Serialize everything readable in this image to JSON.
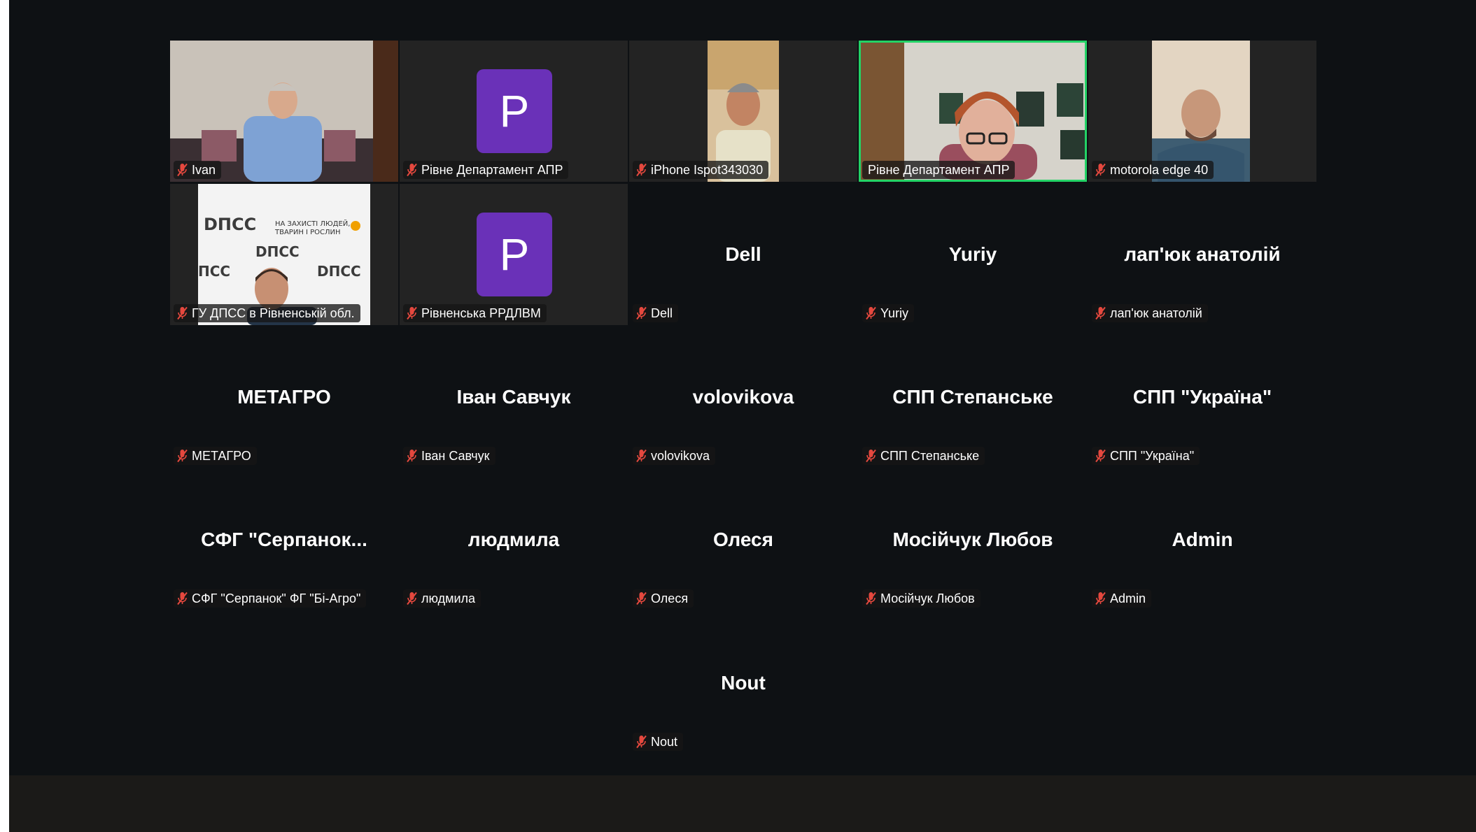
{
  "theme": {
    "background": "#0e1114",
    "tile_background": "#232323",
    "active_speaker_border": "#23d366",
    "avatar_color": "#6a31b8",
    "mute_icon_color": "#e5483e"
  },
  "participants": [
    {
      "label": "Ivan",
      "type": "video",
      "muted": true,
      "icon": "person-video"
    },
    {
      "label": "Рівне Департамент АПР",
      "type": "avatar",
      "avatar_letter": "P",
      "muted": true
    },
    {
      "label": "iPhone Ispot343030",
      "type": "video",
      "muted": true,
      "icon": "person-video"
    },
    {
      "label": "Рівне Департамент АПР",
      "type": "video",
      "active_speaker": true,
      "muted": false,
      "icon": "person-video"
    },
    {
      "label": "motorola edge 40",
      "type": "video",
      "muted": true,
      "icon": "person-video"
    },
    {
      "label": "ГУ ДПСС в Рівненській обл.",
      "type": "video",
      "muted": true,
      "icon": "person-video",
      "backdrop_text": [
        "ДПСС",
        "НА ЗАХИСТІ ЛЮДЕЙ,",
        "ТВАРИН І РОСЛИН"
      ]
    },
    {
      "label": "Рівненська РРДЛВМ",
      "type": "avatar",
      "avatar_letter": "P",
      "muted": true
    },
    {
      "label": "Dell",
      "type": "name",
      "display_name": "Dell",
      "muted": true
    },
    {
      "label": "Yuriy",
      "type": "name",
      "display_name": "Yuriy",
      "muted": true
    },
    {
      "label": "лап'юк анатолій",
      "type": "name",
      "display_name": "лап'юк анатолій",
      "muted": true
    },
    {
      "label": "МЕТАГРО",
      "type": "name",
      "display_name": "МЕТАГРО",
      "muted": true
    },
    {
      "label": "Іван Савчук",
      "type": "name",
      "display_name": "Іван Савчук",
      "muted": true
    },
    {
      "label": "volovikova",
      "type": "name",
      "display_name": "volovikova",
      "muted": true
    },
    {
      "label": "СПП Степанське",
      "type": "name",
      "display_name": "СПП Степанське",
      "muted": true
    },
    {
      "label": "СПП \"Україна\"",
      "type": "name",
      "display_name": "СПП \"Україна\"",
      "muted": true
    },
    {
      "label": "СФГ \"Серпанок\" ФГ \"Бі-Агро\"",
      "type": "name",
      "display_name": "СФГ  \"Серпанок...",
      "muted": true
    },
    {
      "label": "людмила",
      "type": "name",
      "display_name": "людмила",
      "muted": true
    },
    {
      "label": "Олеся",
      "type": "name",
      "display_name": "Олеся",
      "muted": true
    },
    {
      "label": "Мосійчук Любов",
      "type": "name",
      "display_name": "Мосійчук Любов",
      "muted": true
    },
    {
      "label": "Admin",
      "type": "name",
      "display_name": "Admin",
      "muted": true
    },
    {
      "label": "Nout",
      "type": "name",
      "display_name": "Nout",
      "muted": true
    }
  ]
}
